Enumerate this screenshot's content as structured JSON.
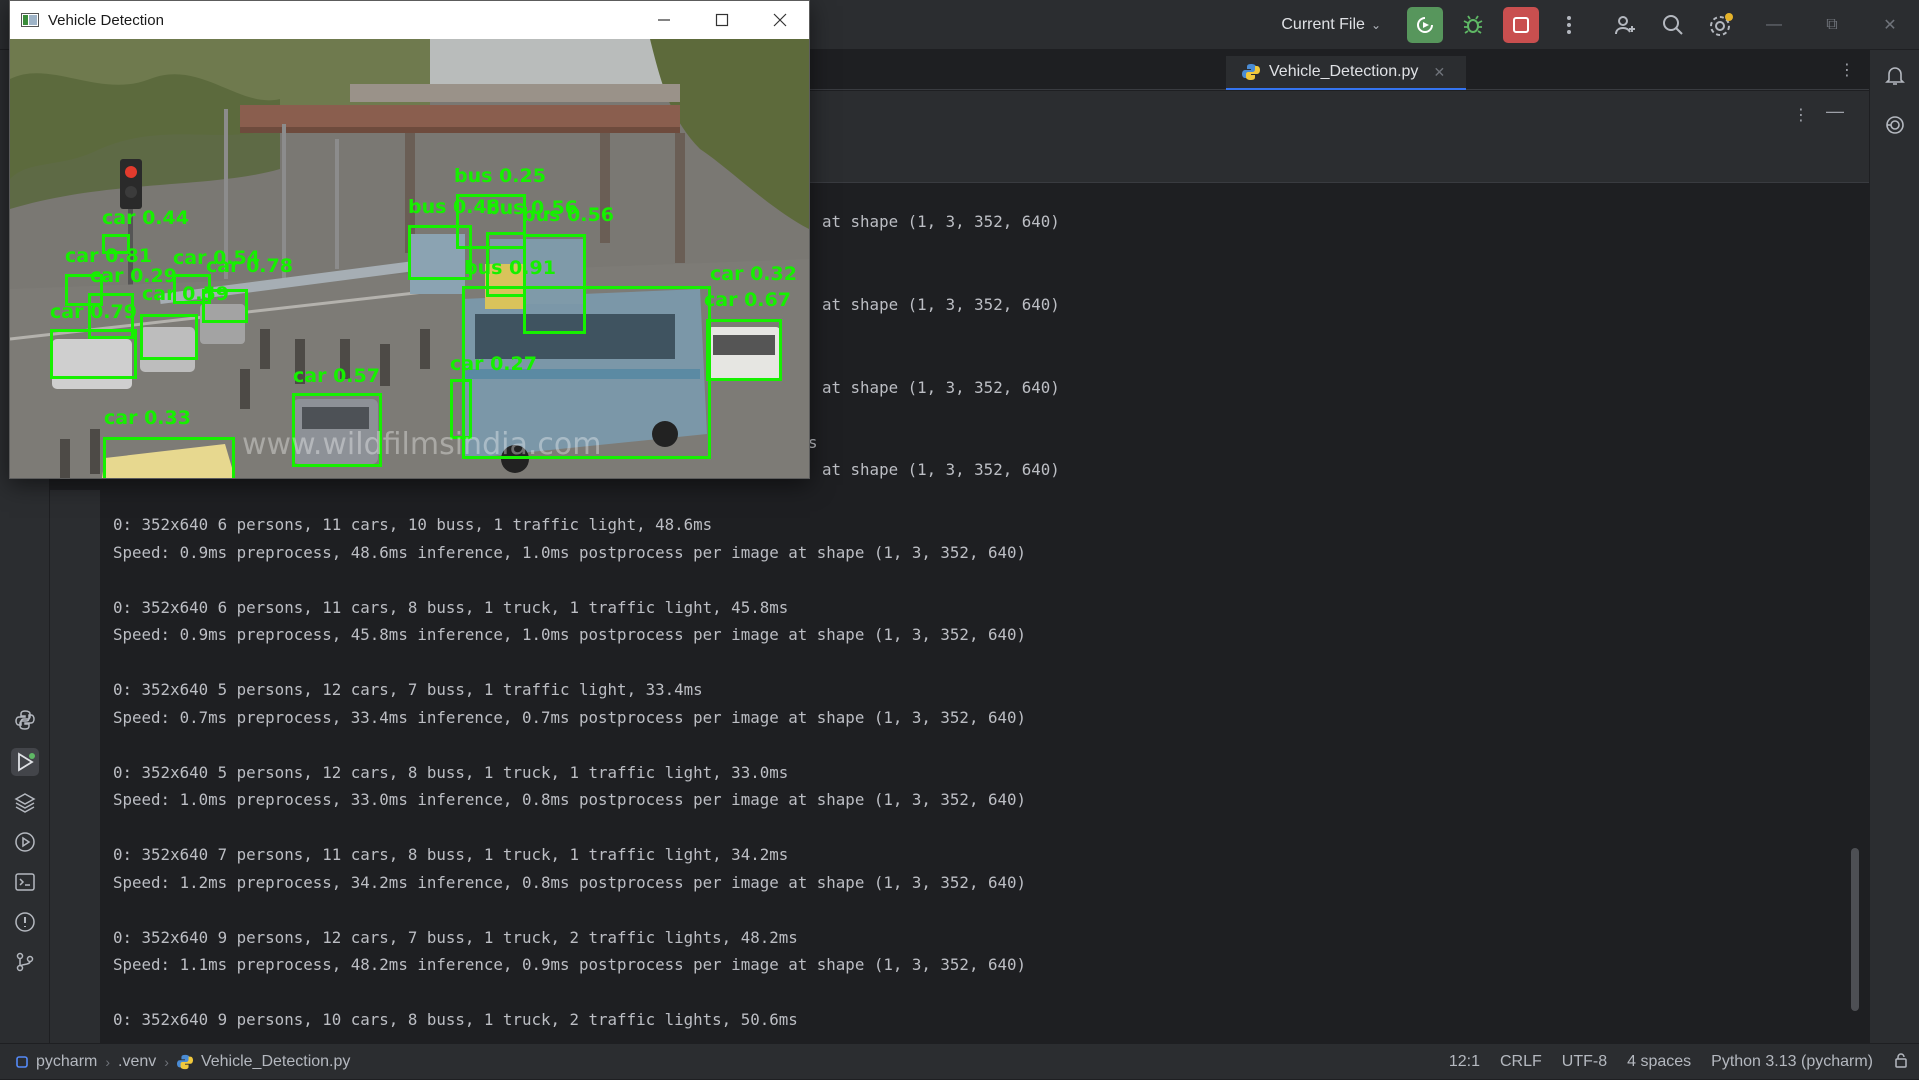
{
  "titlebar": {
    "run_config": "Current File"
  },
  "editor_tab": {
    "filename": "Vehicle_Detection.py"
  },
  "detection_window": {
    "title": "Vehicle Detection",
    "watermark": "www.wildfilmsindia.com",
    "labels": [
      "bus 0.25",
      "bus 0.48",
      "bus 0.56",
      "bus 0.56",
      "car 0.44",
      "car 0.81",
      "car 0.54",
      "car 0.78",
      "car 0.29",
      "car 0.59",
      "car 0.79",
      "bus 0.91",
      "car 0.32",
      "car 0.67",
      "car 0.57",
      "car 0.27",
      "car 0.33"
    ]
  },
  "console": {
    "lines": [
      "at shape (1, 3, 352, 640)",
      "at shape (1, 3, 352, 640)",
      "at shape (1, 3, 352, 640)",
      "s",
      "at shape (1, 3, 352, 640)",
      "0: 352x640 6 persons, 11 cars, 10 buss, 1 traffic light, 48.6ms",
      "Speed: 0.9ms preprocess, 48.6ms inference, 1.0ms postprocess per image at shape (1, 3, 352, 640)",
      "0: 352x640 6 persons, 11 cars, 8 buss, 1 truck, 1 traffic light, 45.8ms",
      "Speed: 0.9ms preprocess, 45.8ms inference, 1.0ms postprocess per image at shape (1, 3, 352, 640)",
      "0: 352x640 5 persons, 12 cars, 7 buss, 1 traffic light, 33.4ms",
      "Speed: 0.7ms preprocess, 33.4ms inference, 0.7ms postprocess per image at shape (1, 3, 352, 640)",
      "0: 352x640 5 persons, 12 cars, 8 buss, 1 truck, 1 traffic light, 33.0ms",
      "Speed: 1.0ms preprocess, 33.0ms inference, 0.8ms postprocess per image at shape (1, 3, 352, 640)",
      "0: 352x640 7 persons, 11 cars, 8 buss, 1 truck, 1 traffic light, 34.2ms",
      "Speed: 1.2ms preprocess, 34.2ms inference, 0.8ms postprocess per image at shape (1, 3, 352, 640)",
      "0: 352x640 9 persons, 12 cars, 7 buss, 1 truck, 2 traffic lights, 48.2ms",
      "Speed: 1.1ms preprocess, 48.2ms inference, 0.9ms postprocess per image at shape (1, 3, 352, 640)",
      "0: 352x640 9 persons, 10 cars, 8 buss, 1 truck, 2 traffic lights, 50.6ms"
    ]
  },
  "statusbar": {
    "project": "pycharm",
    "venv": ".venv",
    "file": "Vehicle_Detection.py",
    "position": "12:1",
    "line_sep": "CRLF",
    "encoding": "UTF-8",
    "indent": "4 spaces",
    "interpreter": "Python 3.13 (pycharm)"
  }
}
